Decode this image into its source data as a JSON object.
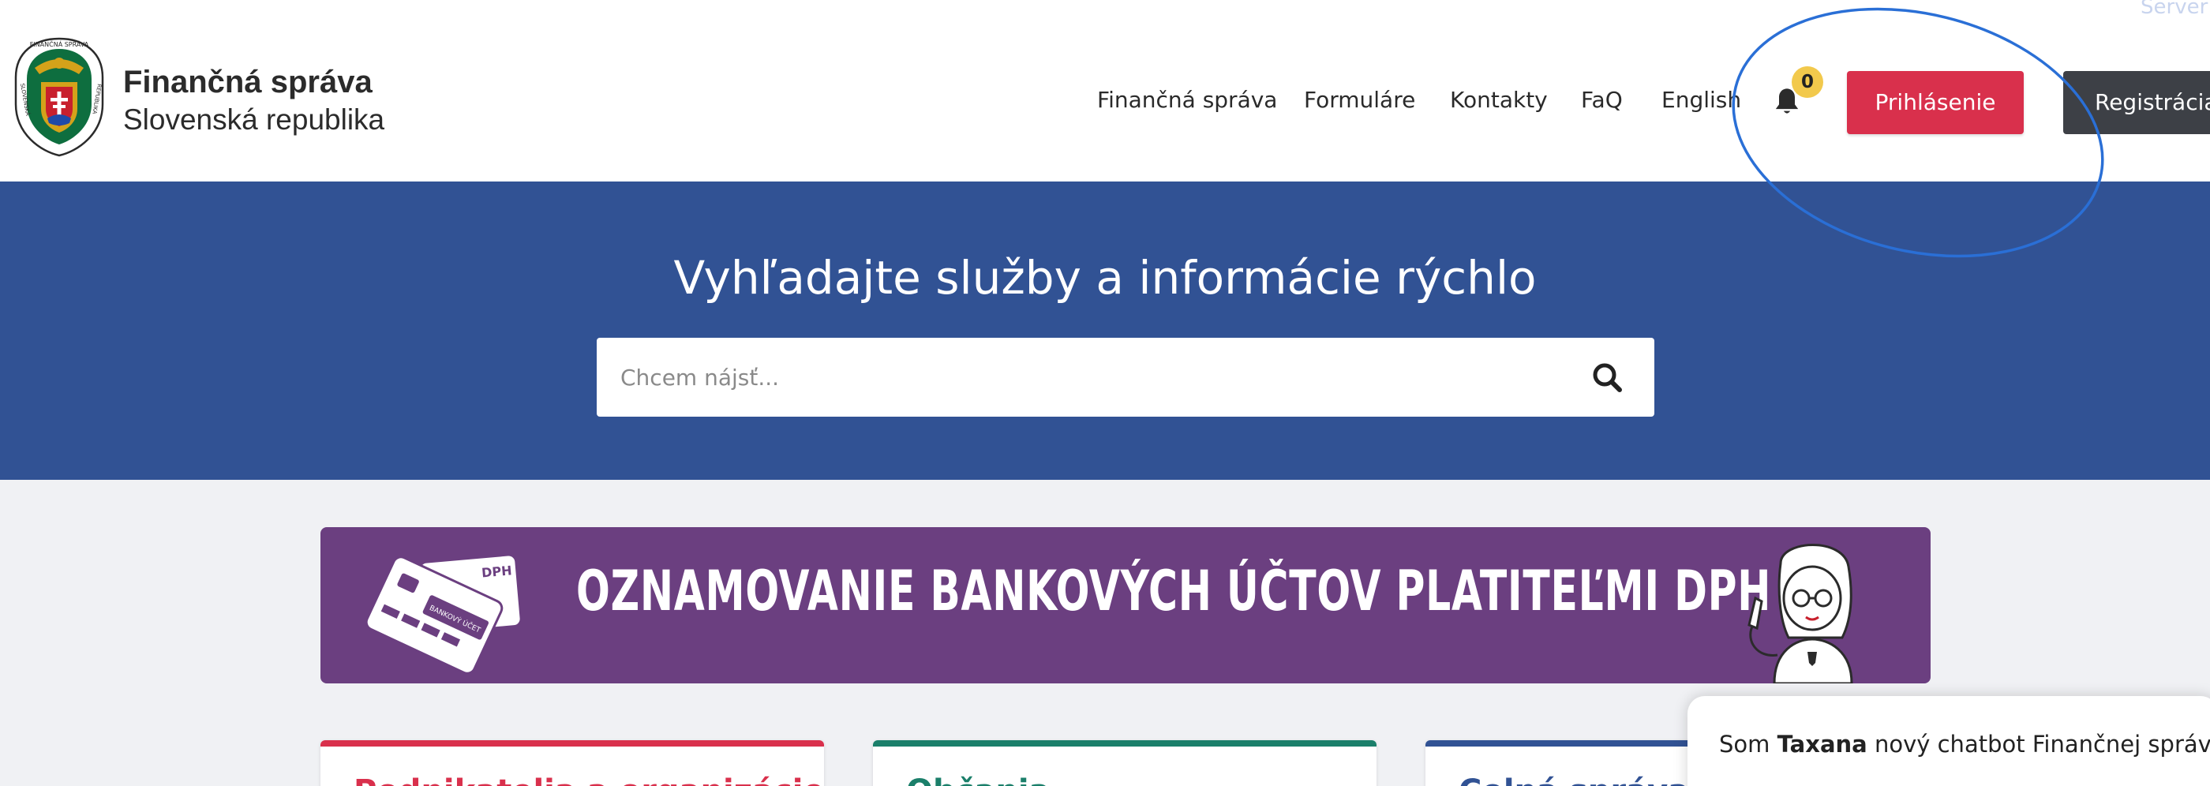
{
  "header": {
    "org_name": "Finančná správa",
    "org_sub": "Slovenská republika",
    "logo": {
      "top_text": "FINANČNÁ SPRÁVA",
      "left_text": "SLOVENSKÁ",
      "right_text": "REPUBLIKA"
    },
    "nav": [
      "Finančná správa",
      "Formuláre",
      "Kontakty",
      "FaQ",
      "English"
    ],
    "notification_count": "0",
    "login_label": "Prihlásenie",
    "register_label": "Registrácia",
    "server_text": "Server"
  },
  "hero": {
    "title": "Vyhľadajte služby a informácie rýchlo",
    "search_placeholder": "Chcem nájsť..."
  },
  "banner": {
    "text": "OZNAMOVANIE BANKOVÝCH ÚČTOV PLATITEĽMI DPH",
    "card_label": "BANKOVÝ ÚČET",
    "card_tag": "DPH"
  },
  "cards": [
    {
      "title": "Podnikatelia a organizácie",
      "accent": "#d9304c"
    },
    {
      "title": "Občania",
      "accent": "#1b7f6a"
    },
    {
      "title": "Colná správa",
      "accent": "#315294"
    }
  ],
  "chatbot": {
    "prefix": "Som ",
    "name": "Taxana",
    "suffix": " nový chatbot Finančnej správy."
  },
  "colors": {
    "hero_bg": "#315294",
    "login_btn": "#d9304c",
    "register_btn": "#3d4046",
    "banner_bg": "#6b3f80",
    "badge": "#f2c94c",
    "annotation": "#2a6fd6"
  },
  "icons": {
    "notifications": "bell-icon",
    "search": "magnifier-icon"
  }
}
